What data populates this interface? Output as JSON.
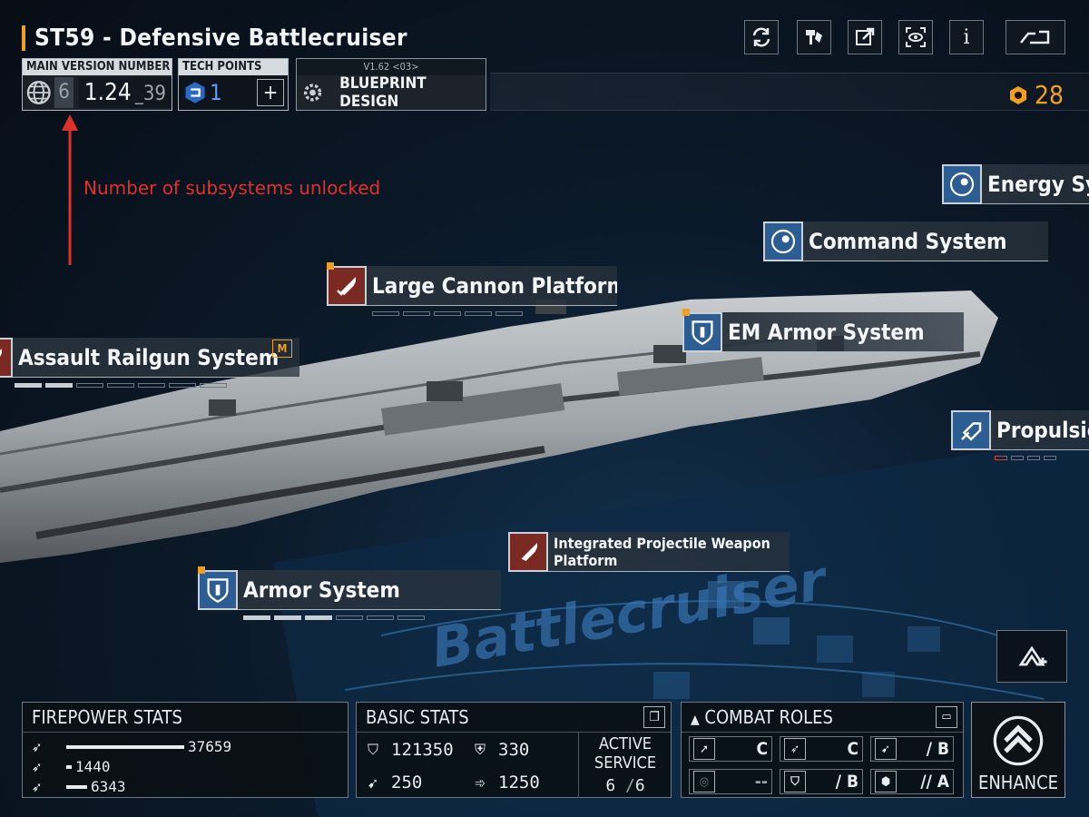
{
  "header": {
    "title": "ST59 - Defensive Battlecruiser",
    "icons": [
      "refresh-icon",
      "paint-icon",
      "share-icon",
      "scan-icon",
      "info-icon",
      "back-icon"
    ],
    "info_label": "i",
    "main_version": {
      "label": "MAIN VERSION NUMBER",
      "subsystems": "6",
      "version": "1.24",
      "subversion": "39"
    },
    "tech_points": {
      "label": "TECH POINTS",
      "value": "1"
    },
    "blueprint": {
      "version": "V1.62 <03>",
      "label": "BLUEPRINT DESIGN"
    },
    "currency": {
      "value": "28",
      "color": "#f0a020"
    }
  },
  "annotation": {
    "text": "Number of subsystems unlocked",
    "color": "#e0302a"
  },
  "subsystems": [
    {
      "name": "Energy Sys",
      "icon": "target-icon",
      "color": "blue"
    },
    {
      "name": "Command System",
      "icon": "target-icon",
      "color": "blue"
    },
    {
      "name": "Large Cannon Platform",
      "icon": "shell-icon",
      "color": "red",
      "levels": [
        0,
        0,
        0,
        0,
        0
      ]
    },
    {
      "name": "EM Armor System",
      "icon": "shield-icon",
      "color": "blue"
    },
    {
      "name": "Assault Railgun System",
      "icon": "shell-icon",
      "color": "red",
      "badge": "M",
      "levels": [
        1,
        1,
        0,
        0,
        0,
        0,
        0
      ]
    },
    {
      "name": "Propulsio",
      "icon": "propulsion-icon",
      "color": "blue"
    },
    {
      "name": "Integrated Projectile Weapon Platform",
      "icon": "shell-icon",
      "color": "red"
    },
    {
      "name": "Armor System",
      "icon": "shield-icon",
      "color": "blue",
      "levels": [
        1,
        1,
        1,
        0,
        0,
        0
      ]
    }
  ],
  "hull_text": "Battlecruiser",
  "firepower": {
    "title": "FIREPOWER STATS",
    "stats": [
      {
        "value": "37659",
        "fraction": 0.62
      },
      {
        "value": "1440",
        "fraction": 0.03
      },
      {
        "value": "6343",
        "fraction": 0.11
      }
    ]
  },
  "basic": {
    "title": "BASIC STATS",
    "hp": "121350",
    "armor": "330",
    "speed": "250",
    "warp": "1250",
    "active_label": "ACTIVE SERVICE",
    "active": "6",
    "active_total": "6"
  },
  "roles": {
    "title": "COMBAT ROLES",
    "items": [
      {
        "grade": "C",
        "icon": "role-attack-icon"
      },
      {
        "grade": "C",
        "icon": "role-strike-icon"
      },
      {
        "grade": "/ B",
        "icon": "role-assault-icon"
      },
      {
        "grade": "--",
        "icon": "role-support-icon"
      },
      {
        "grade": "/ B",
        "icon": "role-defense-icon"
      },
      {
        "grade": "// A",
        "icon": "role-tank-icon"
      }
    ]
  },
  "enhance": {
    "label": "ENHANCE"
  }
}
